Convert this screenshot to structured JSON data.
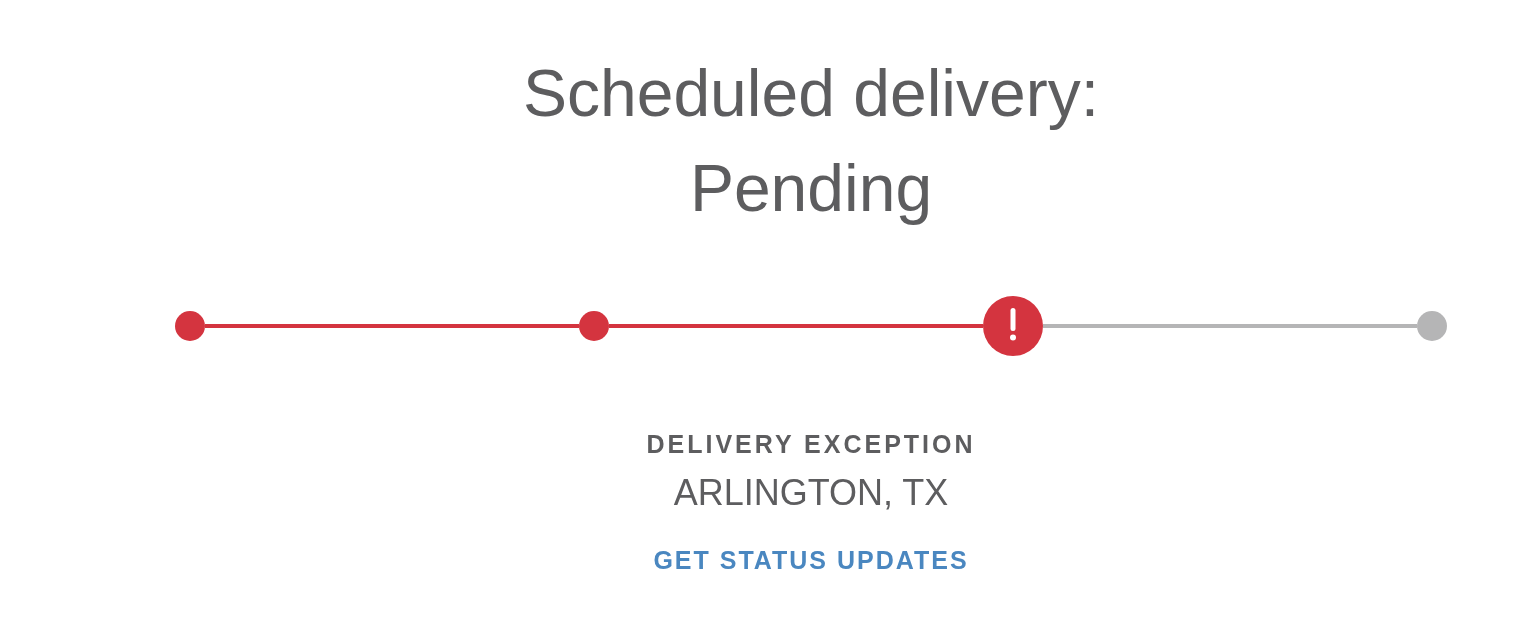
{
  "heading": {
    "label": "Scheduled delivery:",
    "value": "Pending"
  },
  "progress": {
    "steps": [
      {
        "kind": "complete"
      },
      {
        "kind": "complete"
      },
      {
        "kind": "exception"
      },
      {
        "kind": "upcoming"
      }
    ]
  },
  "status": {
    "title": "DELIVERY EXCEPTION",
    "location": "ARLINGTON, TX"
  },
  "link": {
    "label": "GET STATUS UPDATES"
  }
}
